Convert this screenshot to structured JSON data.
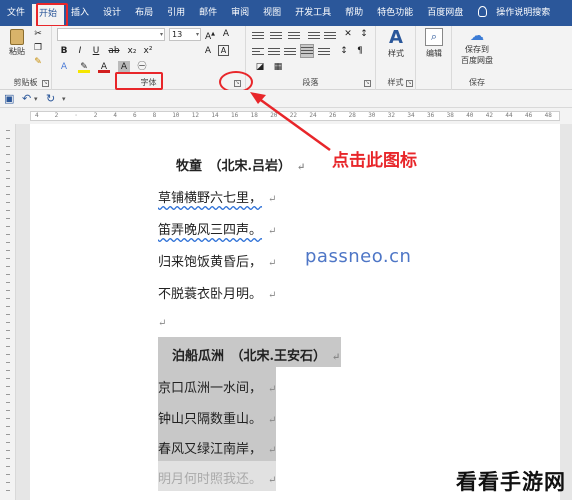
{
  "tabs": [
    {
      "label": "文件"
    },
    {
      "label": "开始"
    },
    {
      "label": "插入"
    },
    {
      "label": "设计"
    },
    {
      "label": "布局"
    },
    {
      "label": "引用"
    },
    {
      "label": "邮件"
    },
    {
      "label": "审阅"
    },
    {
      "label": "视图"
    },
    {
      "label": "开发工具"
    },
    {
      "label": "帮助"
    },
    {
      "label": "特色功能"
    },
    {
      "label": "百度网盘"
    }
  ],
  "tell_me": "操作说明搜索",
  "ribbon": {
    "paste_label": "粘贴",
    "clipboard_label": "剪贴板",
    "font_name": "",
    "font_size": "13",
    "font_group_label": "字体",
    "paragraph_group_label": "段落",
    "styles_label": "样式",
    "styles_group_label": "样式",
    "edit_label": "编辑",
    "save_to_label": "保存到",
    "baidu_label": "百度网盘",
    "save_group_label": "保存",
    "launcher_glyph": "↘"
  },
  "ruler_marks": [
    "4",
    "2",
    "",
    "2",
    "4",
    "6",
    "8",
    "10",
    "12",
    "14",
    "16",
    "18",
    "20",
    "22",
    "24",
    "26",
    "28",
    "30",
    "32",
    "34",
    "36",
    "38",
    "40",
    "42",
    "44",
    "46",
    "48"
  ],
  "document": {
    "poem1_title": "牧童　（北宋.吕岩）",
    "poem1_lines": [
      "草铺横野六七里，",
      "笛弄晚风三四声。",
      "归来饱饭黄昏后，",
      "不脱蓑衣卧月明。"
    ],
    "poem2_title": "泊船瓜洲　（北宋.王安石）",
    "poem2_lines": [
      "京口瓜洲一水间，",
      "钟山只隔数重山。",
      "春风又绿江南岸，",
      "明月何时照我还。"
    ],
    "para_mark": "↵"
  },
  "annotation": {
    "callout": "点击此图标",
    "watermark": "passneo.cn",
    "brand": "看看手游网"
  }
}
